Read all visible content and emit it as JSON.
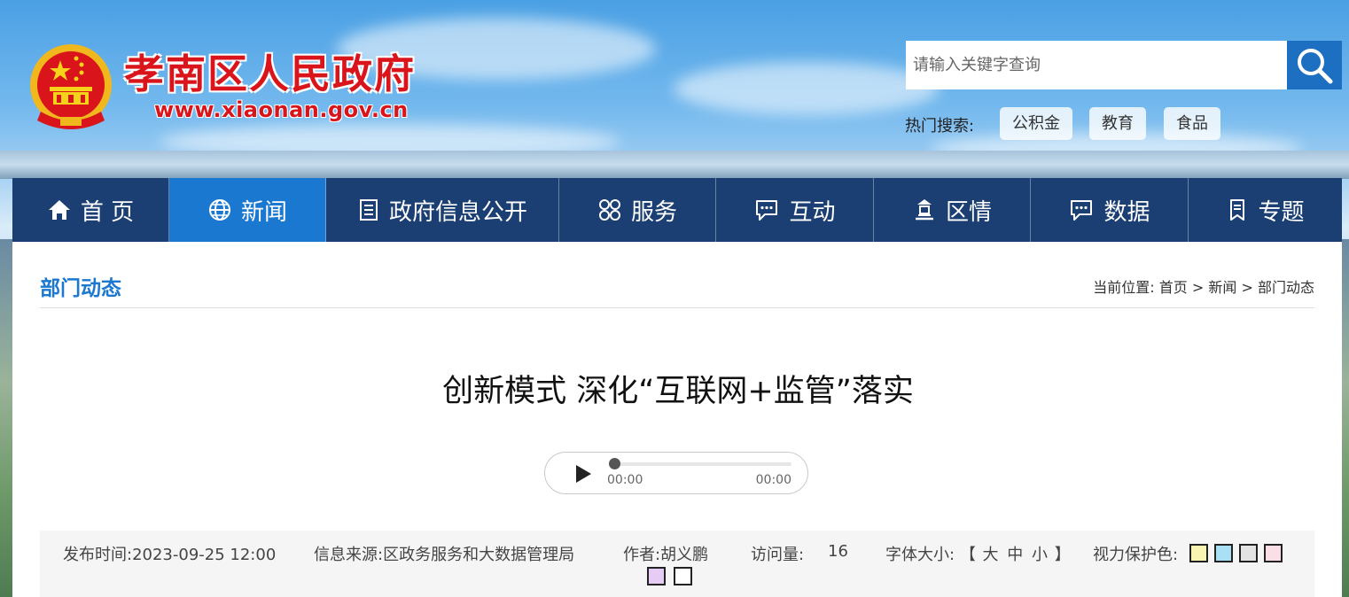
{
  "header": {
    "site_title": "孝南区人民政府",
    "site_url": "www.xiaonan.gov.cn",
    "search": {
      "placeholder": "请输入关键字查询"
    },
    "hot_label": "热门搜索:",
    "hot_tags": [
      "公积金",
      "教育",
      "食品"
    ]
  },
  "nav": {
    "items": [
      {
        "label": "首 页",
        "icon": "home-icon"
      },
      {
        "label": "新闻",
        "icon": "globe-icon",
        "active": true
      },
      {
        "label": "政府信息公开",
        "icon": "document-icon"
      },
      {
        "label": "服务",
        "icon": "services-grid-icon"
      },
      {
        "label": "互动",
        "icon": "chat-icon"
      },
      {
        "label": "区情",
        "icon": "building-icon"
      },
      {
        "label": "数据",
        "icon": "message-icon"
      },
      {
        "label": "专题",
        "icon": "bookmark-icon"
      }
    ]
  },
  "content": {
    "section_title": "部门动态",
    "breadcrumb": {
      "prefix": "当前位置:",
      "items": [
        "首页",
        "新闻",
        "部门动态"
      ],
      "separator": ">"
    },
    "article_title": "创新模式 深化“互联网+监管”落实",
    "audio": {
      "current": "00:00",
      "duration": "00:00",
      "progress": 0
    },
    "meta": {
      "publish_time": "发布时间:2023-09-25 12:00",
      "source": "信息来源:区政务服务和大数据管理局",
      "author": "作者:胡义鹏",
      "views_label": "访问量:",
      "views_value": "16",
      "font_size_label": "字体大小:",
      "font_size_open": "【",
      "font_size_options": [
        "大",
        "中",
        "小"
      ],
      "font_size_close": "】",
      "eye_care_label": "视力保护色:",
      "eye_care_colors": [
        "#faf4b2",
        "#a8e1f5",
        "#e3e3e3",
        "#fae0e6",
        "#e6ccf5",
        "#ffffff"
      ]
    }
  }
}
